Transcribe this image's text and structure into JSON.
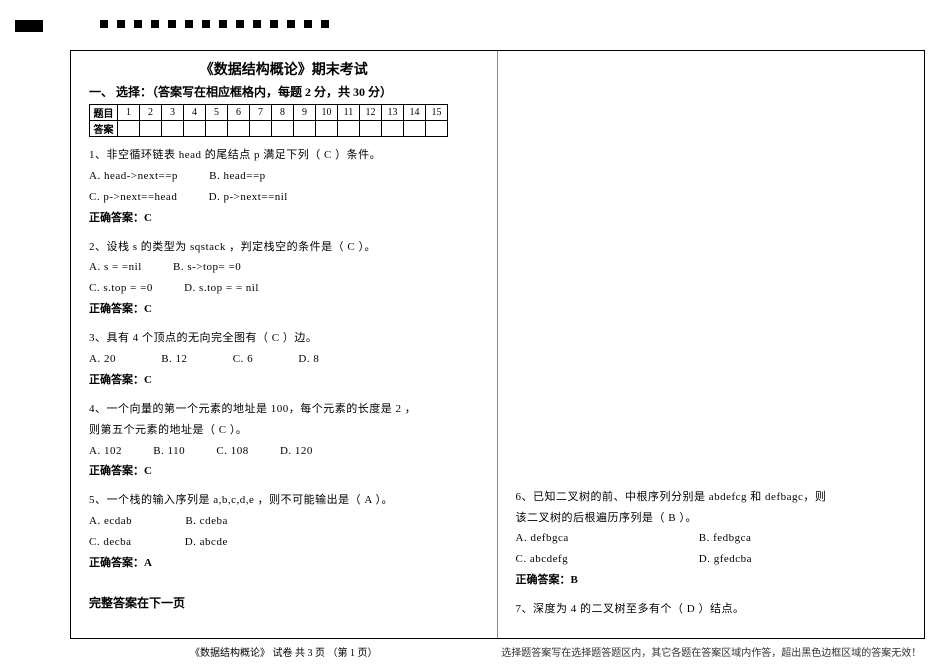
{
  "markers": {
    "count": 14
  },
  "doc": {
    "title": "《数据结构概论》期末考试",
    "section1_heading": "一、  选择：（答案写在相应框格内，每题 2 分，共 30 分）",
    "table": {
      "row1_label": "题目",
      "row2_label": "答案",
      "cols": [
        "1",
        "2",
        "3",
        "4",
        "5",
        "6",
        "7",
        "8",
        "9",
        "10",
        "11",
        "12",
        "13",
        "14",
        "15"
      ]
    },
    "q1": {
      "text": "1、非空循环链表 head 的尾结点 p 满足下列（   C   ）条件。",
      "optA": "A. head->next==p",
      "optB": "B. head==p",
      "optC": "C. p->next==head",
      "optD": "D. p->next==nil",
      "answer": "正确答案：C"
    },
    "q2": {
      "text": "2、设栈 s 的类型为 sqstack ，判定栈空的条件是（   C   ）。",
      "optA": "A. s = =nil",
      "optB": "B. s->top= =0",
      "optC": "C. s.top = =0",
      "optD": "D. s.top = = nil",
      "answer": "正确答案：C"
    },
    "q3": {
      "text": "3、具有 4 个顶点的无向完全图有（   C   ）边。",
      "optA": "A. 20",
      "optB": "B. 12",
      "optC": "C. 6",
      "optD": "D. 8",
      "answer": "正确答案：C"
    },
    "q4": {
      "text1": "4、一个向量的第一个元素的地址是 100，每个元素的长度是 2 ，",
      "text2": "则第五个元素的地址是（  C   ）。",
      "optA": "A. 102",
      "optB": "B. 110",
      "optC": "C. 108",
      "optD": "D. 120",
      "answer": "正确答案：C"
    },
    "q5": {
      "text": "5、一个栈的输入序列是 a,b,c,d,e ，则不可能输出是（  A  ）。",
      "optA": "A. ecdab",
      "optB": "B. cdeba",
      "optC": "C. decba",
      "optD": "D. abcde",
      "answer": "正确答案：A"
    },
    "left_note": "完整答案在下一页",
    "q6": {
      "text1": "6、已知二叉树的前、中根序列分别是 abdefcg 和 defbagc，则",
      "text2": "该二叉树的后根遍历序列是（ B  ）。",
      "optA": "A. defbgca",
      "optB": "B. fedbgca",
      "optC": "C. abcdefg",
      "optD": "D. gfedcba",
      "answer": "正确答案：B"
    },
    "q7": {
      "text": "7、深度为 4 的二叉树至多有个（   D  ）结点。"
    }
  },
  "footer": {
    "left": "《数据结构概论》   试卷  共 3 页  （第 1 页）",
    "right": "选择题答案写在选择题答题区内，其它各题在答案区域内作答，超出黑色边框区域的答案无效！"
  }
}
